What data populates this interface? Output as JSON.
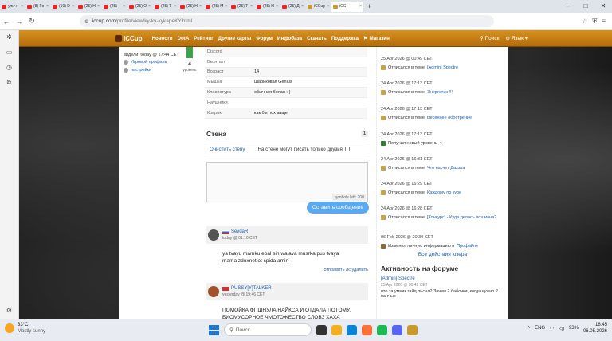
{
  "browser": {
    "tabs": [
      {
        "label": "улич",
        "fav": "youtube"
      },
      {
        "label": "(8) Fo",
        "fav": "youtube"
      },
      {
        "label": "(10) D",
        "fav": "youtube"
      },
      {
        "label": "(25) H",
        "fav": "youtube"
      },
      {
        "label": "(25)",
        "fav": "youtube"
      },
      {
        "label": "(25) O",
        "fav": "youtube"
      },
      {
        "label": "(25) T",
        "fav": "youtube"
      },
      {
        "label": "(25) H",
        "fav": "youtube"
      },
      {
        "label": "(25) M",
        "fav": "youtube"
      },
      {
        "label": "(25) T",
        "fav": "youtube"
      },
      {
        "label": "(25) H",
        "fav": "youtube"
      },
      {
        "label": "(25) Д",
        "fav": "youtube"
      },
      {
        "label": "iCCup",
        "fav": "iccup"
      },
      {
        "label": "iCC",
        "fav": "iccup",
        "active": true
      }
    ],
    "url_domain": "iccup.com",
    "url_path": "/profile/view/ky-ky-kykapeKY.html"
  },
  "site": {
    "logo": "iCCup",
    "nav": [
      "Новости",
      "DotA",
      "Рейтинг",
      "Другие карты",
      "Форум",
      "Инфобаза",
      "Скачать",
      "Поддержка"
    ],
    "shop": "Магазин",
    "search": "Поиск",
    "lang": "Язык"
  },
  "profile": {
    "seen": "видели: today @ 17:44 CET",
    "links": [
      "Игровой профиль",
      "настройки"
    ],
    "level": "4",
    "level_label": "уровень",
    "info": [
      {
        "k": "Discord",
        "v": ""
      },
      {
        "k": "Вконтакт",
        "v": ""
      },
      {
        "k": "Возраст",
        "v": "14"
      },
      {
        "k": "Мышка",
        "v": "Шариковая Genius"
      },
      {
        "k": "Клавиатура",
        "v": "обычная белая :-)"
      },
      {
        "k": "Наушники",
        "v": ""
      },
      {
        "k": "Коврик",
        "v": "как бы пох ваще"
      }
    ]
  },
  "wall": {
    "title": "Стена",
    "count": "1",
    "clear": "Очистить стену",
    "only_friends": "На стене могут писать только друзья",
    "symbols_left": "symbols left: 200",
    "send": "Оставить сообщение",
    "posts": [
      {
        "name": "SevdaR",
        "time": "today @ 01:10 CET",
        "text": "ya tvayu mamku ebal sin walava musrka pus tvaya mama zdoxnet ot spida amin",
        "actions": "отправить лс  удалить"
      },
      {
        "name": "PUSSY[Y]TALKER",
        "time": "yesterday @ 19:46 CET",
        "text": "ПОМОЙКА ФПШНУЛА НАЙКСА И ОТДАЛА ПОТОМУ, БИОМУСОРНОЕ ЧМОТОЖЕСТВО СЛОВЗ ХАХА",
        "actions": ""
      }
    ]
  },
  "activity": [
    {
      "date": "25 Apr 2026 @ 00:49 CET",
      "text": "Отписался в теме",
      "link": "[Admin] Spectre",
      "icon": "note"
    },
    {
      "date": "24 Apr 2026 @ 17:13 CET",
      "text": "Отписался в теме",
      "link": "Энергетик !!!",
      "icon": "note"
    },
    {
      "date": "24 Apr 2026 @ 17:13 CET",
      "text": "Отписался в теме",
      "link": "Весеннее обострение",
      "icon": "note"
    },
    {
      "date": "24 Apr 2026 @ 17:13 CET",
      "text": "Получил новый уровень",
      "link": "4",
      "icon": "level"
    },
    {
      "date": "24 Apr 2026 @ 16:31 CET",
      "text": "Отписался в теме",
      "link": "Что насчет Дазэла",
      "icon": "note"
    },
    {
      "date": "24 Apr 2026 @ 16:29 CET",
      "text": "Отписался в теме",
      "link": "Каждому по куре",
      "icon": "note"
    },
    {
      "date": "24 Apr 2026 @ 16:28 CET",
      "text": "Отписался в теме",
      "link": "[Конкурс] - Куда делась вся мана?",
      "icon": "note"
    },
    {
      "date": "06 Feb 2026 @ 20:30 CET",
      "text": "Изменил личную информацию в",
      "link": "Профайле",
      "icon": "pen"
    }
  ],
  "all_activity": "Все действия юзера",
  "forum": {
    "title": "Активность на форуме",
    "items": [
      {
        "title": "[Admin] Spectre",
        "date": "25 Apr 2026 @ 00:49 CET",
        "text": "что за умник гайд писал? Зачем 2 бабочки, когда нужно 2 ванчью"
      }
    ]
  },
  "taskbar": {
    "temp": "33°C",
    "weather": "Mostly sunny",
    "search": "Поиск",
    "lang": "ENG",
    "battery": "93%",
    "time": "18:45",
    "date": "06.05.2026"
  }
}
